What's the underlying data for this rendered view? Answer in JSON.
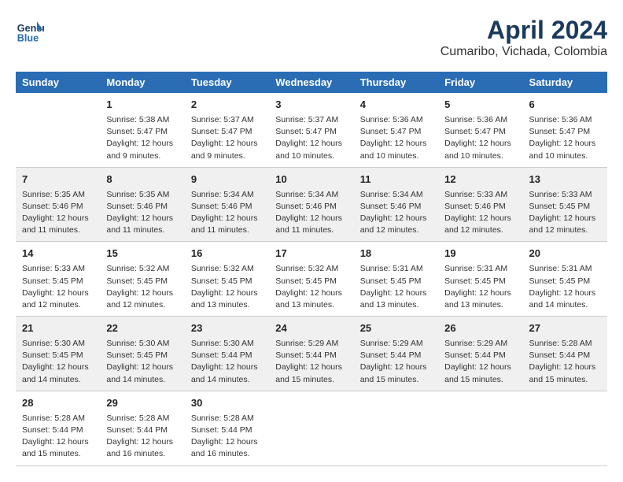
{
  "header": {
    "logo_line1": "General",
    "logo_line2": "Blue",
    "title": "April 2024",
    "subtitle": "Cumaribo, Vichada, Colombia"
  },
  "weekdays": [
    "Sunday",
    "Monday",
    "Tuesday",
    "Wednesday",
    "Thursday",
    "Friday",
    "Saturday"
  ],
  "weeks": [
    [
      {
        "day": "",
        "info": ""
      },
      {
        "day": "1",
        "info": "Sunrise: 5:38 AM\nSunset: 5:47 PM\nDaylight: 12 hours\nand 9 minutes."
      },
      {
        "day": "2",
        "info": "Sunrise: 5:37 AM\nSunset: 5:47 PM\nDaylight: 12 hours\nand 9 minutes."
      },
      {
        "day": "3",
        "info": "Sunrise: 5:37 AM\nSunset: 5:47 PM\nDaylight: 12 hours\nand 10 minutes."
      },
      {
        "day": "4",
        "info": "Sunrise: 5:36 AM\nSunset: 5:47 PM\nDaylight: 12 hours\nand 10 minutes."
      },
      {
        "day": "5",
        "info": "Sunrise: 5:36 AM\nSunset: 5:47 PM\nDaylight: 12 hours\nand 10 minutes."
      },
      {
        "day": "6",
        "info": "Sunrise: 5:36 AM\nSunset: 5:47 PM\nDaylight: 12 hours\nand 10 minutes."
      }
    ],
    [
      {
        "day": "7",
        "info": "Sunrise: 5:35 AM\nSunset: 5:46 PM\nDaylight: 12 hours\nand 11 minutes."
      },
      {
        "day": "8",
        "info": "Sunrise: 5:35 AM\nSunset: 5:46 PM\nDaylight: 12 hours\nand 11 minutes."
      },
      {
        "day": "9",
        "info": "Sunrise: 5:34 AM\nSunset: 5:46 PM\nDaylight: 12 hours\nand 11 minutes."
      },
      {
        "day": "10",
        "info": "Sunrise: 5:34 AM\nSunset: 5:46 PM\nDaylight: 12 hours\nand 11 minutes."
      },
      {
        "day": "11",
        "info": "Sunrise: 5:34 AM\nSunset: 5:46 PM\nDaylight: 12 hours\nand 12 minutes."
      },
      {
        "day": "12",
        "info": "Sunrise: 5:33 AM\nSunset: 5:46 PM\nDaylight: 12 hours\nand 12 minutes."
      },
      {
        "day": "13",
        "info": "Sunrise: 5:33 AM\nSunset: 5:45 PM\nDaylight: 12 hours\nand 12 minutes."
      }
    ],
    [
      {
        "day": "14",
        "info": "Sunrise: 5:33 AM\nSunset: 5:45 PM\nDaylight: 12 hours\nand 12 minutes."
      },
      {
        "day": "15",
        "info": "Sunrise: 5:32 AM\nSunset: 5:45 PM\nDaylight: 12 hours\nand 12 minutes."
      },
      {
        "day": "16",
        "info": "Sunrise: 5:32 AM\nSunset: 5:45 PM\nDaylight: 12 hours\nand 13 minutes."
      },
      {
        "day": "17",
        "info": "Sunrise: 5:32 AM\nSunset: 5:45 PM\nDaylight: 12 hours\nand 13 minutes."
      },
      {
        "day": "18",
        "info": "Sunrise: 5:31 AM\nSunset: 5:45 PM\nDaylight: 12 hours\nand 13 minutes."
      },
      {
        "day": "19",
        "info": "Sunrise: 5:31 AM\nSunset: 5:45 PM\nDaylight: 12 hours\nand 13 minutes."
      },
      {
        "day": "20",
        "info": "Sunrise: 5:31 AM\nSunset: 5:45 PM\nDaylight: 12 hours\nand 14 minutes."
      }
    ],
    [
      {
        "day": "21",
        "info": "Sunrise: 5:30 AM\nSunset: 5:45 PM\nDaylight: 12 hours\nand 14 minutes."
      },
      {
        "day": "22",
        "info": "Sunrise: 5:30 AM\nSunset: 5:45 PM\nDaylight: 12 hours\nand 14 minutes."
      },
      {
        "day": "23",
        "info": "Sunrise: 5:30 AM\nSunset: 5:44 PM\nDaylight: 12 hours\nand 14 minutes."
      },
      {
        "day": "24",
        "info": "Sunrise: 5:29 AM\nSunset: 5:44 PM\nDaylight: 12 hours\nand 15 minutes."
      },
      {
        "day": "25",
        "info": "Sunrise: 5:29 AM\nSunset: 5:44 PM\nDaylight: 12 hours\nand 15 minutes."
      },
      {
        "day": "26",
        "info": "Sunrise: 5:29 AM\nSunset: 5:44 PM\nDaylight: 12 hours\nand 15 minutes."
      },
      {
        "day": "27",
        "info": "Sunrise: 5:28 AM\nSunset: 5:44 PM\nDaylight: 12 hours\nand 15 minutes."
      }
    ],
    [
      {
        "day": "28",
        "info": "Sunrise: 5:28 AM\nSunset: 5:44 PM\nDaylight: 12 hours\nand 15 minutes."
      },
      {
        "day": "29",
        "info": "Sunrise: 5:28 AM\nSunset: 5:44 PM\nDaylight: 12 hours\nand 16 minutes."
      },
      {
        "day": "30",
        "info": "Sunrise: 5:28 AM\nSunset: 5:44 PM\nDaylight: 12 hours\nand 16 minutes."
      },
      {
        "day": "",
        "info": ""
      },
      {
        "day": "",
        "info": ""
      },
      {
        "day": "",
        "info": ""
      },
      {
        "day": "",
        "info": ""
      }
    ]
  ]
}
